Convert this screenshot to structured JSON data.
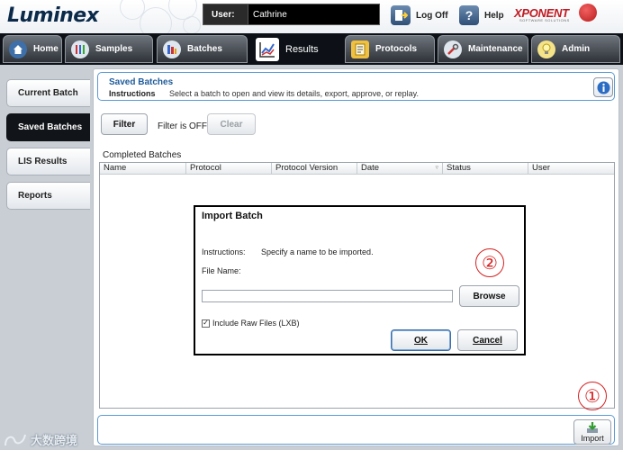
{
  "app": {
    "logo_text": "Luminex",
    "brand_text": "XPONENT",
    "brand_sub": "SOFTWARE SOLUTIONS"
  },
  "topbar": {
    "user_label": "User:",
    "user_name": "Cathrine",
    "logoff_label": "Log Off",
    "help_label": "Help"
  },
  "nav": {
    "tabs": [
      {
        "label": "Home",
        "icon": "house-icon"
      },
      {
        "label": "Samples",
        "icon": "samples-icon"
      },
      {
        "label": "Batches",
        "icon": "batches-icon"
      },
      {
        "label": "Results",
        "icon": "results-chart-icon",
        "active": true
      },
      {
        "label": "Protocols",
        "icon": "protocols-icon"
      },
      {
        "label": "Maintenance",
        "icon": "maintenance-icon"
      },
      {
        "label": "Admin",
        "icon": "admin-icon"
      }
    ]
  },
  "sidebar": {
    "items": [
      {
        "label": "Current Batch"
      },
      {
        "label": "Saved Batches",
        "active": true
      },
      {
        "label": "LIS Results"
      },
      {
        "label": "Reports"
      }
    ]
  },
  "header": {
    "title": "Saved Batches",
    "instructions_label": "Instructions",
    "instructions_text": "Select a batch to open and view its details, export, approve, or replay."
  },
  "filter": {
    "filter_label": "Filter",
    "status": "Filter is OFF",
    "clear_label": "Clear"
  },
  "table": {
    "section_label": "Completed Batches",
    "columns": [
      "Name",
      "Protocol",
      "Protocol Version",
      "Date",
      "Status",
      "User"
    ],
    "rows": []
  },
  "footer": {
    "import_label": "Import"
  },
  "dialog": {
    "title": "Import Batch",
    "instructions_label": "Instructions:",
    "instructions_text": "Specify a name to be imported.",
    "file_name_label": "File Name:",
    "file_name_value": "",
    "browse_label": "Browse",
    "checkbox_label": "Include Raw Files (LXB)",
    "checkbox_checked": true,
    "ok_label": "OK",
    "cancel_label": "Cancel"
  },
  "annotations": {
    "marker_1": "①",
    "marker_2": "②"
  },
  "watermark": {
    "text": "大数跨境"
  },
  "colors": {
    "accent_blue": "#5b9bd5",
    "title_blue": "#1f5c99",
    "nav_dark": "#0d1117",
    "annotation_red": "#d42020"
  }
}
